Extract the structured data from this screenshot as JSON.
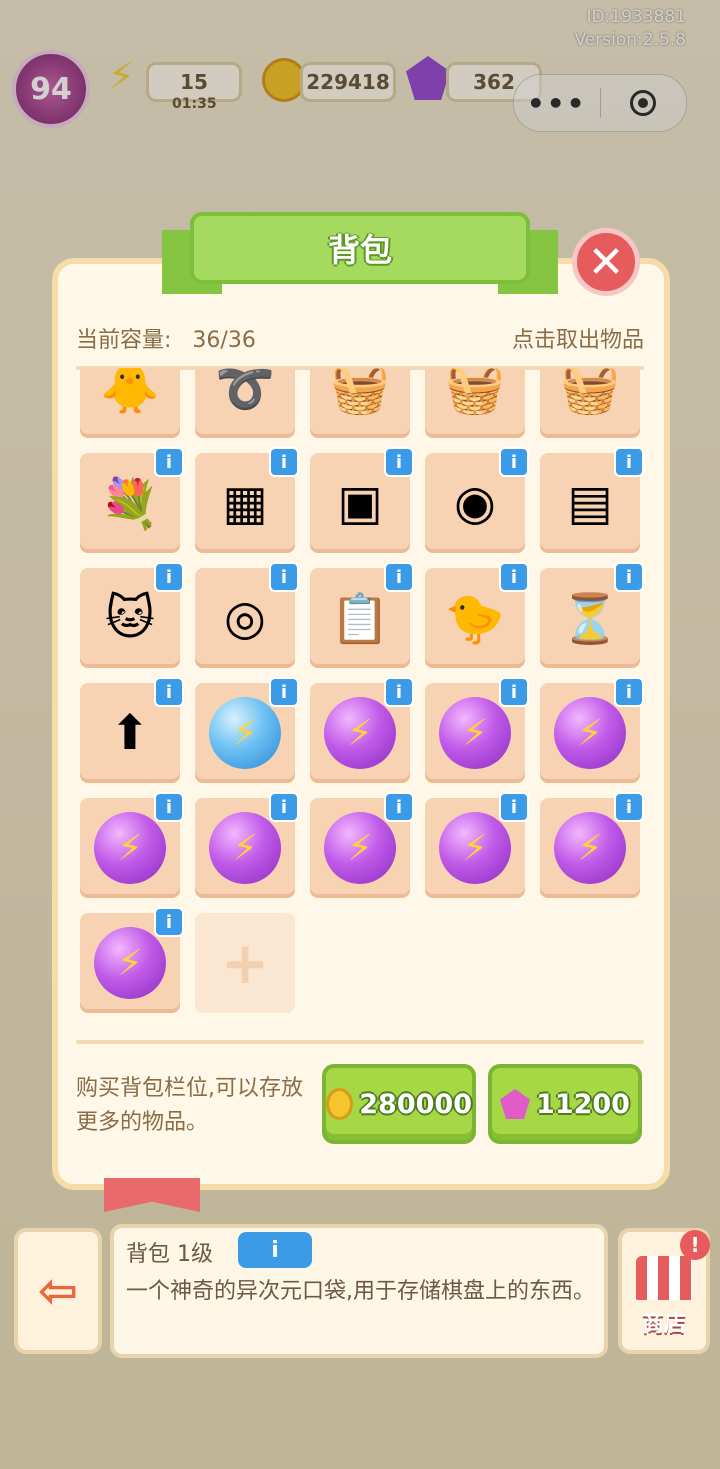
{
  "system": {
    "id_text": "ID:1933881",
    "version_text": "Version:2.5.8"
  },
  "hud": {
    "level": "94",
    "energy": "15",
    "energy_timer": "01:35",
    "coins": "229418",
    "gems": "362"
  },
  "mini_program_capsule": {
    "more_icon": "more-dots-icon",
    "close_icon": "target-icon"
  },
  "backpack": {
    "title": "背包",
    "capacity_label": "当前容量:",
    "capacity_value": "36/36",
    "hint": "点击取出物品",
    "items": [
      {
        "name": "duck-headphones-toy",
        "glyph": "🐥",
        "info": false
      },
      {
        "name": "rope-coil",
        "glyph": "➰",
        "info": false
      },
      {
        "name": "empty-basket",
        "glyph": "🧺",
        "info": false
      },
      {
        "name": "handle-basket",
        "glyph": "🧺",
        "info": false
      },
      {
        "name": "flower-basket",
        "glyph": "🧺",
        "info": false
      },
      {
        "name": "bouquet-basket",
        "glyph": "💐",
        "info": true
      },
      {
        "name": "cpu-chip",
        "glyph": "▦",
        "info": true
      },
      {
        "name": "circuit-board",
        "glyph": "▣",
        "info": true
      },
      {
        "name": "robot-vacuum",
        "glyph": "◉",
        "info": true
      },
      {
        "name": "vacuum-station",
        "glyph": "▤",
        "info": true
      },
      {
        "name": "orange-cat",
        "glyph": "🐱",
        "info": true
      },
      {
        "name": "duck-swim-ring",
        "glyph": "◎",
        "info": true
      },
      {
        "name": "clipboard-report",
        "glyph": "📋",
        "info": true
      },
      {
        "name": "chick-plush",
        "glyph": "🐤",
        "info": true
      },
      {
        "name": "pink-hourglass-gem",
        "glyph": "⏳",
        "info": true
      },
      {
        "name": "green-upgrade-card",
        "glyph": "⬆",
        "info": true
      },
      {
        "name": "blue-energy-orb",
        "glyph": "⚡",
        "info": true,
        "orb": "blue"
      },
      {
        "name": "purple-energy-orb",
        "glyph": "⚡",
        "info": true,
        "orb": "purple"
      },
      {
        "name": "purple-energy-orb",
        "glyph": "⚡",
        "info": true,
        "orb": "purple"
      },
      {
        "name": "purple-energy-orb",
        "glyph": "⚡",
        "info": true,
        "orb": "purple"
      },
      {
        "name": "purple-energy-orb",
        "glyph": "⚡",
        "info": true,
        "orb": "purple"
      },
      {
        "name": "purple-energy-orb",
        "glyph": "⚡",
        "info": true,
        "orb": "purple"
      },
      {
        "name": "purple-energy-orb",
        "glyph": "⚡",
        "info": true,
        "orb": "purple"
      },
      {
        "name": "purple-energy-orb",
        "glyph": "⚡",
        "info": true,
        "orb": "purple"
      },
      {
        "name": "purple-energy-orb",
        "glyph": "⚡",
        "info": true,
        "orb": "purple"
      },
      {
        "name": "purple-energy-orb",
        "glyph": "⚡",
        "info": true,
        "orb": "purple"
      }
    ],
    "add_slot_glyph": "+",
    "buy_text": "购买背包栏位,可以存放更多的物品。",
    "buy_coins_price": "280000",
    "buy_gems_price": "11200"
  },
  "bottom": {
    "title": "背包 1级",
    "info_icon": "i",
    "description": "一个神奇的异次元口袋,用于存储棋盘上的东西。",
    "exit_icon": "exit-door-icon",
    "shop_label": "商店",
    "shop_alert": "!"
  },
  "colors": {
    "accent_green": "#a6da5e",
    "close_red": "#e65b5b",
    "info_blue": "#3c9be6",
    "modal_bg": "#fff8e8"
  }
}
